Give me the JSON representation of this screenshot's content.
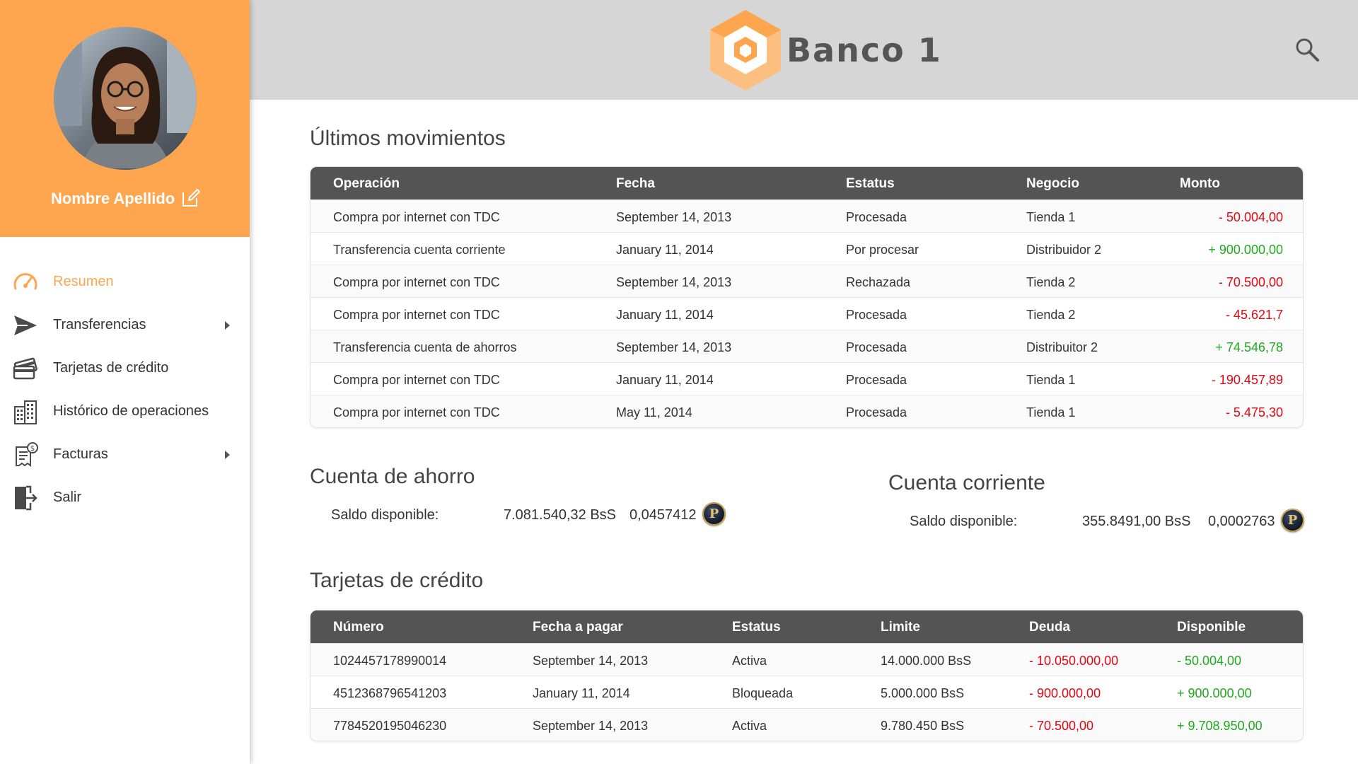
{
  "profile": {
    "name": "Nombre Apellido"
  },
  "brand": {
    "name": "Banco 1",
    "accent": "#FDA64F"
  },
  "menu": [
    {
      "label": "Resumen",
      "icon": "speedometer-icon",
      "active": true,
      "has_submenu": false
    },
    {
      "label": "Transferencias",
      "icon": "send-icon",
      "active": false,
      "has_submenu": true
    },
    {
      "label": "Tarjetas de crédito",
      "icon": "credit-cards-icon",
      "active": false,
      "has_submenu": false
    },
    {
      "label": "Histórico de operaciones",
      "icon": "building-history-icon",
      "active": false,
      "has_submenu": false
    },
    {
      "label": "Facturas",
      "icon": "invoice-icon",
      "active": false,
      "has_submenu": true
    },
    {
      "label": "Salir",
      "icon": "logout-icon",
      "active": false,
      "has_submenu": false
    }
  ],
  "movements": {
    "title": "Últimos movimientos",
    "headers": [
      "Operación",
      "Fecha",
      "Estatus",
      "Negocio",
      "Monto"
    ],
    "rows": [
      {
        "operacion": "Compra por internet con TDC",
        "fecha": "September 14, 2013",
        "estatus": "Procesada",
        "negocio": "Tienda 1",
        "monto": "- 50.004,00",
        "sign": "neg"
      },
      {
        "operacion": "Transferencia cuenta corriente",
        "fecha": "January 11, 2014",
        "estatus": "Por procesar",
        "negocio": "Distribuidor 2",
        "monto": "+ 900.000,00",
        "sign": "pos"
      },
      {
        "operacion": "Compra por internet con TDC",
        "fecha": "September 14, 2013",
        "estatus": "Rechazada",
        "negocio": "Tienda 2",
        "monto": "- 70.500,00",
        "sign": "neg"
      },
      {
        "operacion": "Compra por internet con TDC",
        "fecha": "January 11, 2014",
        "estatus": "Procesada",
        "negocio": "Tienda 2",
        "monto": "- 45.621,7",
        "sign": "neg"
      },
      {
        "operacion": "Transferencia cuenta de ahorros",
        "fecha": "September 14, 2013",
        "estatus": "Procesada",
        "negocio": "Distribuitor 2",
        "monto": "+ 74.546,78",
        "sign": "pos"
      },
      {
        "operacion": "Compra por internet con TDC",
        "fecha": "January 11, 2014",
        "estatus": "Procesada",
        "negocio": "Tienda 1",
        "monto": "- 190.457,89",
        "sign": "neg"
      },
      {
        "operacion": "Compra por internet con TDC",
        "fecha": "May 11, 2014",
        "estatus": "Procesada",
        "negocio": "Tienda 1",
        "monto": "- 5.475,30",
        "sign": "neg"
      }
    ]
  },
  "savings": {
    "title": "Cuenta de ahorro",
    "label": "Saldo disponible:",
    "amount": "7.081.540,32 BsS",
    "crypto": "0,0457412"
  },
  "checking": {
    "title": "Cuenta corriente",
    "label": "Saldo disponible:",
    "amount": "355.8491,00 BsS",
    "crypto": "0,0002763"
  },
  "cards": {
    "title": "Tarjetas de crédito",
    "headers": [
      "Número",
      "Fecha a pagar",
      "Estatus",
      "Limite",
      "Deuda",
      "Disponible"
    ],
    "rows": [
      {
        "numero": "1024457178990014",
        "fecha": "September 14, 2013",
        "estatus": "Activa",
        "limite": "14.000.000 BsS",
        "deuda": "- 10.050.000,00",
        "disponible": "- 50.004,00",
        "disp_sign": "pos"
      },
      {
        "numero": "4512368796541203",
        "fecha": "January 11, 2014",
        "estatus": "Bloqueada",
        "limite": "5.000.000 BsS",
        "deuda": "- 900.000,00",
        "disponible": "+ 900.000,00",
        "disp_sign": "pos"
      },
      {
        "numero": "7784520195046230",
        "fecha": "September 14, 2013",
        "estatus": "Activa",
        "limite": "9.780.450 BsS",
        "deuda": "- 70.500,00",
        "disponible": "+ 9.708.950,00",
        "disp_sign": "pos"
      }
    ]
  },
  "colors": {
    "header_bg": "#D6D6D6",
    "table_head": "#545454",
    "negative": "#E30613",
    "positive": "#1DAA1D"
  }
}
